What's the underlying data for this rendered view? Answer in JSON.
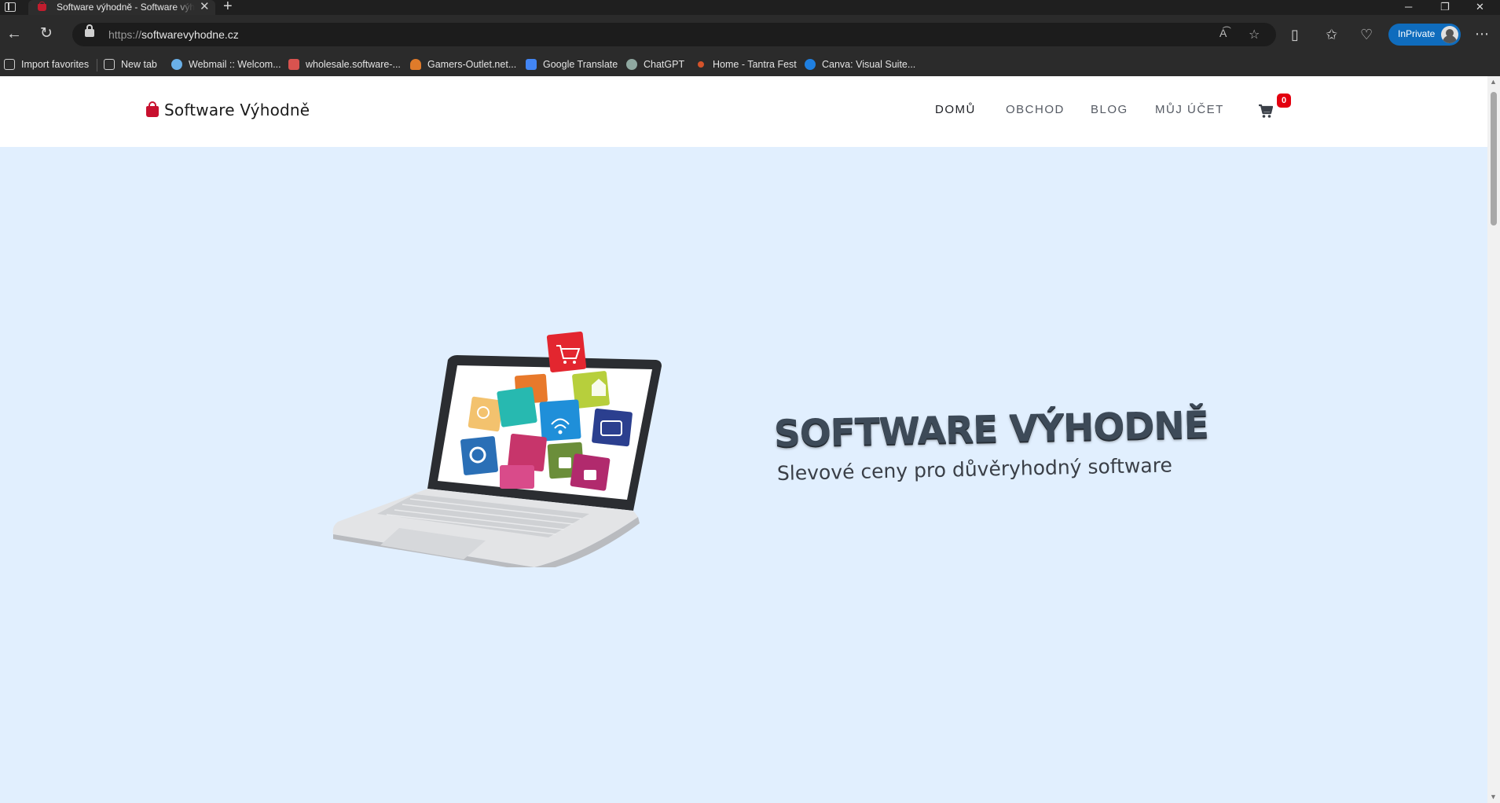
{
  "browser": {
    "tab_title": "Software výhodně - Software výhodně",
    "url_scheme": "https://",
    "url_host": "softwarevyhodne.cz",
    "inprivate_label": "InPrivate",
    "bookmarks": [
      {
        "label": "Import favorites",
        "icon": "import-favorites-icon",
        "color": "#cfcfcf"
      },
      {
        "label": "New tab",
        "icon": "new-tab-icon",
        "color": "#cfcfcf"
      },
      {
        "label": "Webmail :: Welcom...",
        "icon": "webmail-icon",
        "color": "#6ab0e8"
      },
      {
        "label": "wholesale.software-...",
        "icon": "wholesale-icon",
        "color": "#d9534f"
      },
      {
        "label": "Gamers-Outlet.net...",
        "icon": "gamers-outlet-icon",
        "color": "#e07b2a"
      },
      {
        "label": "Google Translate",
        "icon": "google-translate-icon",
        "color": "#4285f4"
      },
      {
        "label": "ChatGPT",
        "icon": "chatgpt-icon",
        "color": "#8fa8a0"
      },
      {
        "label": "Home - Tantra Fest",
        "icon": "tantra-fest-icon",
        "color": "#d4532a"
      },
      {
        "label": "Canva: Visual Suite...",
        "icon": "canva-icon",
        "color": "#1f7fe0"
      }
    ]
  },
  "site": {
    "logo_text": "Software Výhodně",
    "nav": [
      {
        "label": "DOMŮ",
        "active": true
      },
      {
        "label": "OBCHOD",
        "active": false
      },
      {
        "label": "BLOG",
        "active": false
      },
      {
        "label": "MŮJ ÚČET",
        "active": false
      }
    ],
    "cart_count": "0",
    "hero": {
      "title": "SOFTWARE VÝHODNĚ",
      "subtitle": "Slevové ceny pro důvěryhodný software",
      "background": "#e1effe"
    }
  },
  "colors": {
    "accent_red": "#c8102e",
    "badge_red": "#e3000f",
    "inprivate_blue": "#0f6cbd"
  }
}
